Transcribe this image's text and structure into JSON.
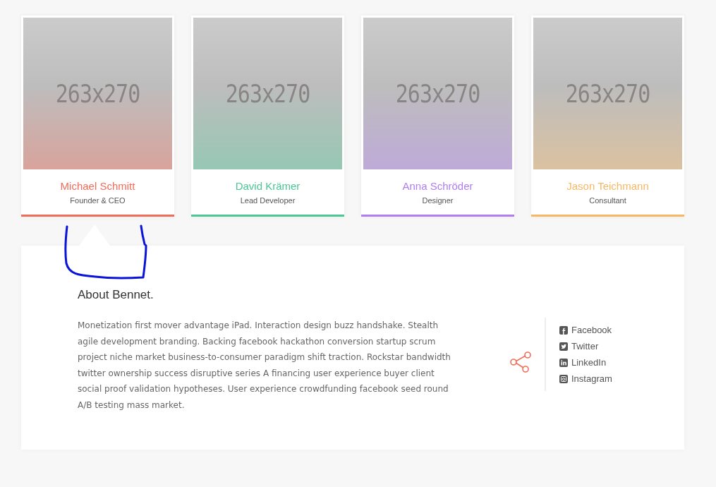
{
  "team": [
    {
      "placeholder": "263x270",
      "name": "Michael Schmitt",
      "role": "Founder & CEO",
      "color": "#f26c5a",
      "selected": true
    },
    {
      "placeholder": "263x270",
      "name": "David Krämer",
      "role": "Lead Developer",
      "color": "#4cc796",
      "selected": false
    },
    {
      "placeholder": "263x270",
      "name": "Anna Schröder",
      "role": "Designer",
      "color": "#b07ef0",
      "selected": false
    },
    {
      "placeholder": "263x270",
      "name": "Jason Teichmann",
      "role": "Consultant",
      "color": "#f7b865",
      "selected": false
    }
  ],
  "about": {
    "title": "About Bennet.",
    "text": "Monetization first mover advantage iPad. Interaction design buzz handshake. Stealth agile development branding. Backing facebook hackathon conversion startup scrum project niche market business-to-consumer paradigm shift traction. Rockstar bandwidth twitter ownership success disruptive series A financing user experience buyer client social proof validation hypotheses. User experience crowdfunding facebook seed round A/B testing mass market.",
    "social": [
      {
        "kind": "facebook",
        "label": "Facebook"
      },
      {
        "kind": "twitter",
        "label": "Twitter"
      },
      {
        "kind": "linkedin",
        "label": "LinkedIn"
      },
      {
        "kind": "instagram",
        "label": "Instagram"
      }
    ]
  }
}
